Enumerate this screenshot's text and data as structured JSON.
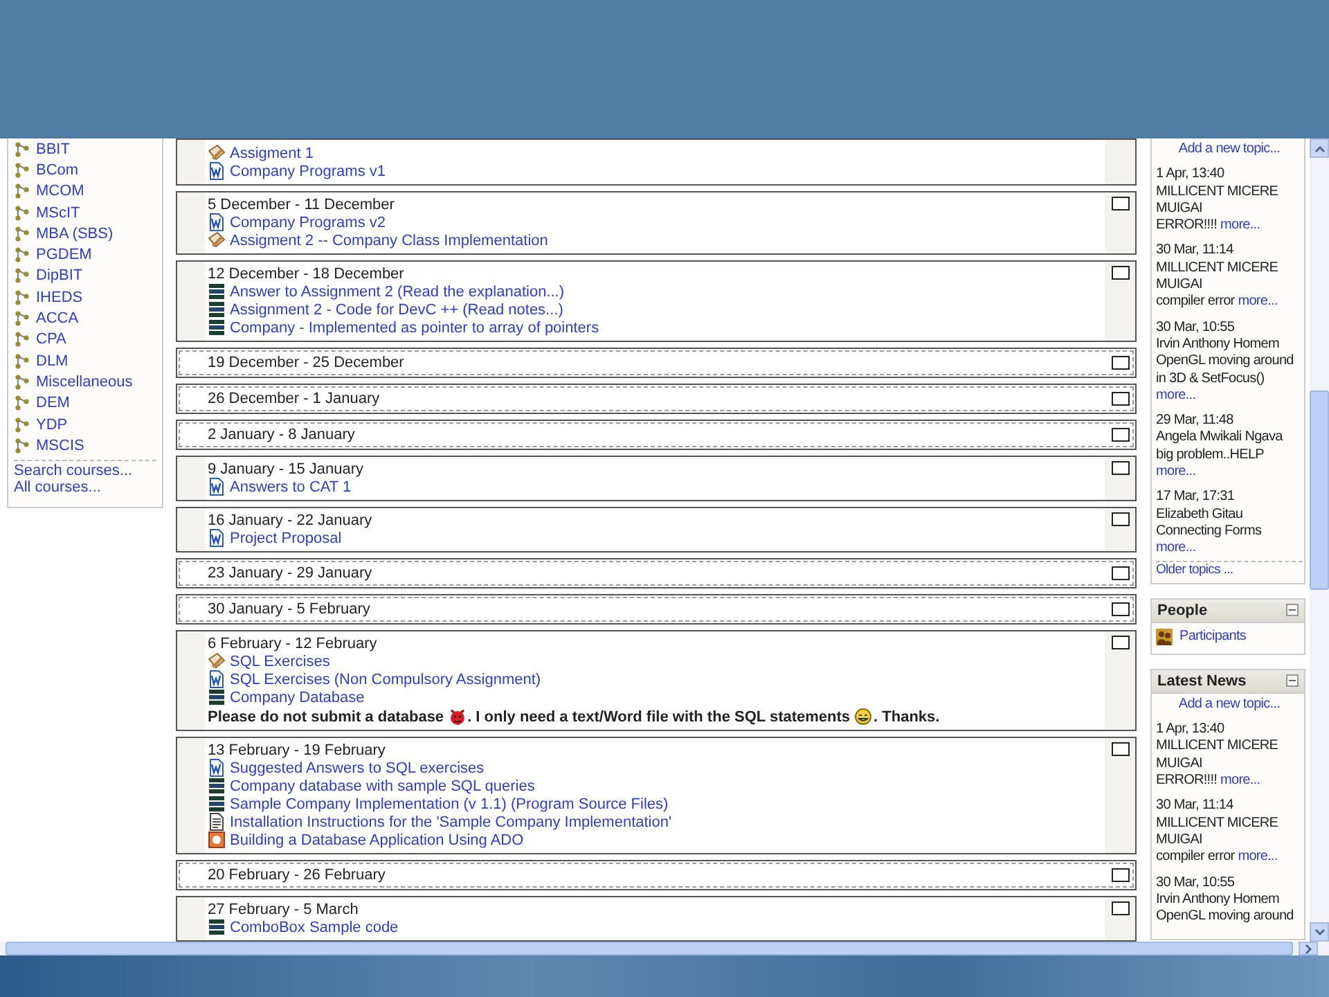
{
  "course_categories": {
    "items": [
      "BBIT",
      "BCom",
      "MCOM",
      "MScIT",
      "MBA (SBS)",
      "PGDEM",
      "DipBIT",
      "IHEDS",
      "ACCA",
      "CPA",
      "DLM",
      "Miscellaneous",
      "DEM",
      "YDP",
      "MSCIS"
    ],
    "links": [
      "Search courses...",
      "All courses..."
    ]
  },
  "weeks": [
    {
      "items": [
        {
          "kind": "assignment",
          "label": "Assigment 1"
        },
        {
          "kind": "doc",
          "label": "Company Programs v1"
        }
      ]
    },
    {
      "title": "5 December - 11 December",
      "items": [
        {
          "kind": "doc",
          "label": "Company Programs v2"
        },
        {
          "kind": "assignment",
          "label": "Assigment 2 -- Company Class Implementation"
        }
      ]
    },
    {
      "title": "12 December - 18 December",
      "items": [
        {
          "kind": "stack",
          "label": "Answer to Assignment 2 (Read the explanation...)"
        },
        {
          "kind": "stack",
          "label": "Assignment 2 - Code for DevC ++ (Read notes...)"
        },
        {
          "kind": "stack",
          "label": "Company - Implemented as pointer to array of pointers"
        }
      ]
    },
    {
      "title": "19 December - 25 December"
    },
    {
      "title": "26 December - 1 January"
    },
    {
      "title": "2 January - 8 January"
    },
    {
      "title": "9 January - 15 January",
      "items": [
        {
          "kind": "doc",
          "label": "Answers to CAT 1"
        }
      ]
    },
    {
      "title": "16 January - 22 January",
      "items": [
        {
          "kind": "doc",
          "label": "Project Proposal"
        }
      ]
    },
    {
      "title": "23 January - 29 January"
    },
    {
      "title": "30 January - 5 February"
    },
    {
      "title": "6 February - 12 February",
      "items": [
        {
          "kind": "assignment",
          "label": "SQL Exercises"
        },
        {
          "kind": "doc",
          "label": "SQL Exercises (Non Compulsory Assignment)"
        },
        {
          "kind": "stack",
          "label": "Company Database"
        }
      ],
      "note": [
        {
          "kind": "text",
          "text": "Please do not submit a database"
        },
        {
          "kind": "devil"
        },
        {
          "kind": "text",
          "text": ". I only need a text/Word file with the SQL statements"
        },
        {
          "kind": "grin"
        },
        {
          "kind": "text",
          "text": ". Thanks."
        }
      ]
    },
    {
      "title": "13 February - 19 February",
      "items": [
        {
          "kind": "doc",
          "label": "Suggested Answers to SQL exercises"
        },
        {
          "kind": "stack",
          "label": "Company database with sample SQL queries"
        },
        {
          "kind": "stack",
          "label": "Sample Company Implementation (v 1.1) (Program Source Files)"
        },
        {
          "kind": "text",
          "label": "Installation Instructions for the 'Sample Company Implementation'"
        },
        {
          "kind": "slides",
          "label": "Building a Database Application Using ADO"
        }
      ]
    },
    {
      "title": "20 February - 26 February"
    },
    {
      "title": "27 February - 5 March",
      "items": [
        {
          "kind": "stack",
          "label": "ComboBox Sample code"
        }
      ]
    }
  ],
  "recent_topics": {
    "add_link": "Add a new topic...",
    "posts": [
      {
        "date": "1 Apr, 13:40",
        "author": "MILLICENT MICERE MUIGAI",
        "subject": "ERROR!!!!",
        "more": "more..."
      },
      {
        "date": "30 Mar, 11:14",
        "author": "MILLICENT MICERE MUIGAI",
        "subject": "compiler error",
        "more": "more..."
      },
      {
        "date": "30 Mar, 10:55",
        "author": "Irvin Anthony Homem",
        "subject": "OpenGL moving around in 3D & SetFocus()",
        "more": "more..."
      },
      {
        "date": "29 Mar, 11:48",
        "author": "Angela Mwikali Ngava",
        "subject": "big problem..HELP",
        "more": "more..."
      },
      {
        "date": "17 Mar, 17:31",
        "author": "Elizabeth Gitau",
        "subject": "Connecting Forms",
        "more": "more..."
      }
    ],
    "older_link": "Older topics ..."
  },
  "people": {
    "title": "People",
    "items": [
      "Participants"
    ]
  },
  "latest_news": {
    "title": "Latest News",
    "add_link": "Add a new topic...",
    "posts": [
      {
        "date": "1 Apr, 13:40",
        "author": "MILLICENT MICERE MUIGAI",
        "subject": "ERROR!!!!",
        "more": "more..."
      },
      {
        "date": "30 Mar, 11:14",
        "author": "MILLICENT MICERE MUIGAI",
        "subject": "compiler error",
        "more": "more..."
      },
      {
        "date": "30 Mar, 10:55",
        "author": "Irvin Anthony Homem",
        "subject": "OpenGL moving around"
      }
    ]
  }
}
